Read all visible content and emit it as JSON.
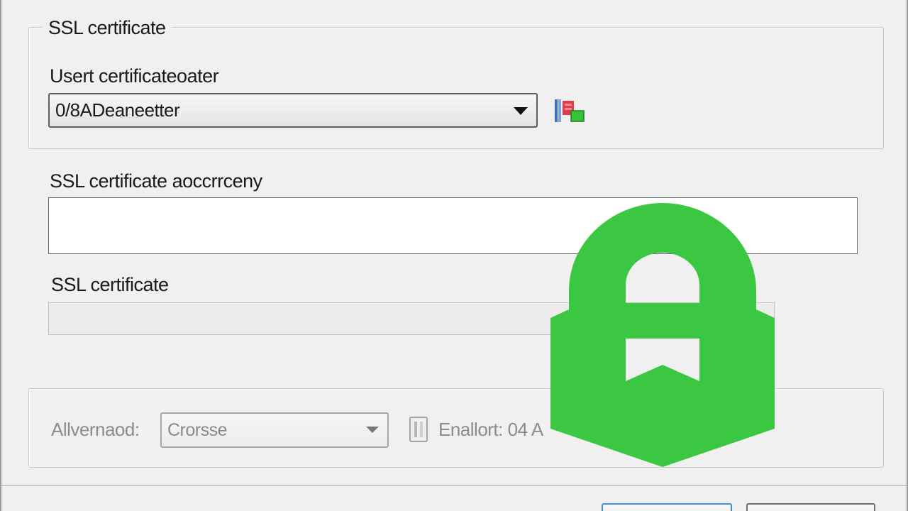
{
  "ssl_group": {
    "legend": "SSL certificate",
    "user_certificate_label": "Usert certificateoater",
    "user_certificate_value": "0/8ADeaneetter"
  },
  "accessory": {
    "label": "SSL certificate aoccrrceny",
    "value": ""
  },
  "certificate": {
    "label": "SSL certificate",
    "value": ""
  },
  "advanced": {
    "label": "Allvernaod:",
    "combo_value": "Crorsse",
    "enable_label": "Enallort: 04 A"
  },
  "colors": {
    "lock_green": "#3cc743",
    "default_button_border": "#3d8fd6"
  },
  "icons": {
    "certificate_picker": "certificate-icon",
    "overlay": "padlock-icon",
    "enable_toggle": "checkbox-icon"
  }
}
